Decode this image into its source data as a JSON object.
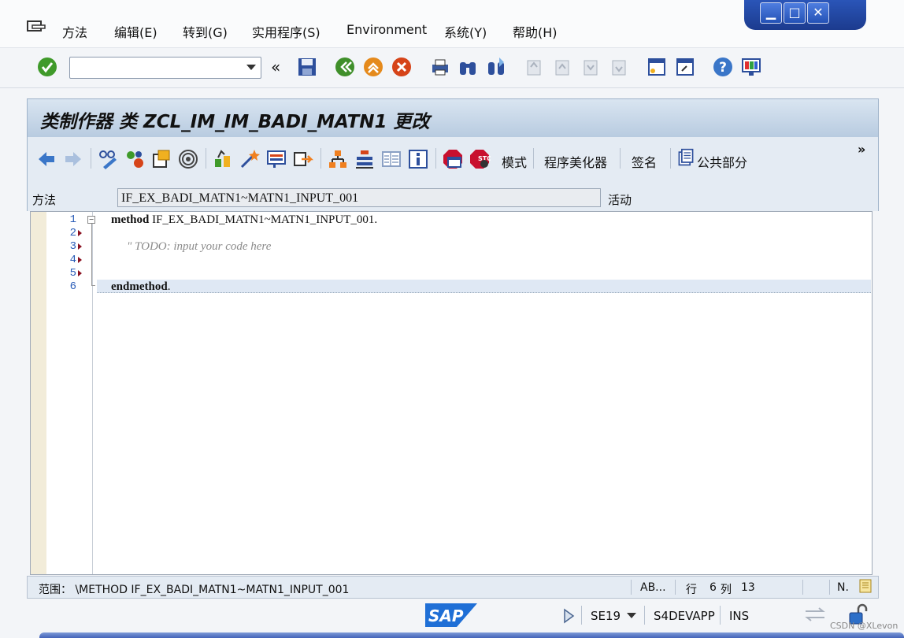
{
  "menu": [
    "方法",
    "编辑(E)",
    "转到(G)",
    "实用程序(S)",
    "Environment",
    "系统(Y)",
    "帮助(H)"
  ],
  "window_controls": {
    "minimize": "▁",
    "maximize": "□",
    "close": "✕"
  },
  "command_field": {
    "value": ""
  },
  "title": "类制作器 类 ZCL_IM_IM_BADI_MATN1 更改",
  "app_toolbar": {
    "mode": "模式",
    "pretty_printer": "程序美化器",
    "signature": "签名",
    "public_section": "公共部分",
    "more": "»"
  },
  "method_row": {
    "label": "方法",
    "value": "IF_EX_BADI_MATN1~MATN1_INPUT_001",
    "status": "活动"
  },
  "editor": {
    "line_numbers": [
      "1",
      "2",
      "3",
      "4",
      "5",
      "6"
    ],
    "line1_keyword": "method",
    "line1_rest": " IF_EX_BADI_MATN1~MATN1_INPUT_001.",
    "line3_comment": "\" TODO: input your code here",
    "line6_keyword": "endmethod",
    "line6_rest": "."
  },
  "scope_bar": {
    "scope": "范围：  \\METHOD IF_EX_BADI_MATN1~MATN1_INPUT_001",
    "mode": "AB...",
    "row_label": "行",
    "row": "6",
    "col_label": "列",
    "col": "13",
    "n": "N."
  },
  "status_bar": {
    "transaction": "SE19",
    "system": "S4DEVAPP",
    "ins": "INS",
    "logo": "SAP"
  },
  "watermark": "CSDN @XLevon",
  "colors": {
    "title_band": "#c8d8ea",
    "accent_blue": "#2452b6",
    "gutter": "#f2ecd9"
  }
}
